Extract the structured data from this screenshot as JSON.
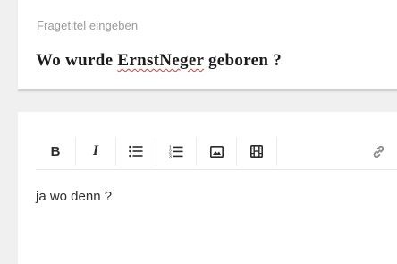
{
  "question": {
    "title_label": "Fragetitel eingeben",
    "title_before": "Wo wurde ",
    "title_misspelled": "ErnstNeger",
    "title_after": " geboren ?"
  },
  "toolbar": {
    "buttons": [
      {
        "name": "bold-button",
        "icon": "bold",
        "glyph": "B"
      },
      {
        "name": "italic-button",
        "icon": "italic",
        "glyph": "I"
      },
      {
        "name": "bulleted-list-button",
        "icon": "bulleted-list-icon"
      },
      {
        "name": "numbered-list-button",
        "icon": "numbered-list-icon"
      },
      {
        "name": "insert-image-button",
        "icon": "image-icon"
      },
      {
        "name": "insert-video-button",
        "icon": "film-icon"
      },
      {
        "name": "insert-link-button",
        "icon": "link-icon"
      }
    ]
  },
  "editor": {
    "content": "ja wo denn ?"
  },
  "colors": {
    "background": "#f0f0f0",
    "card": "#ffffff",
    "spellcheck": "#e53935"
  }
}
